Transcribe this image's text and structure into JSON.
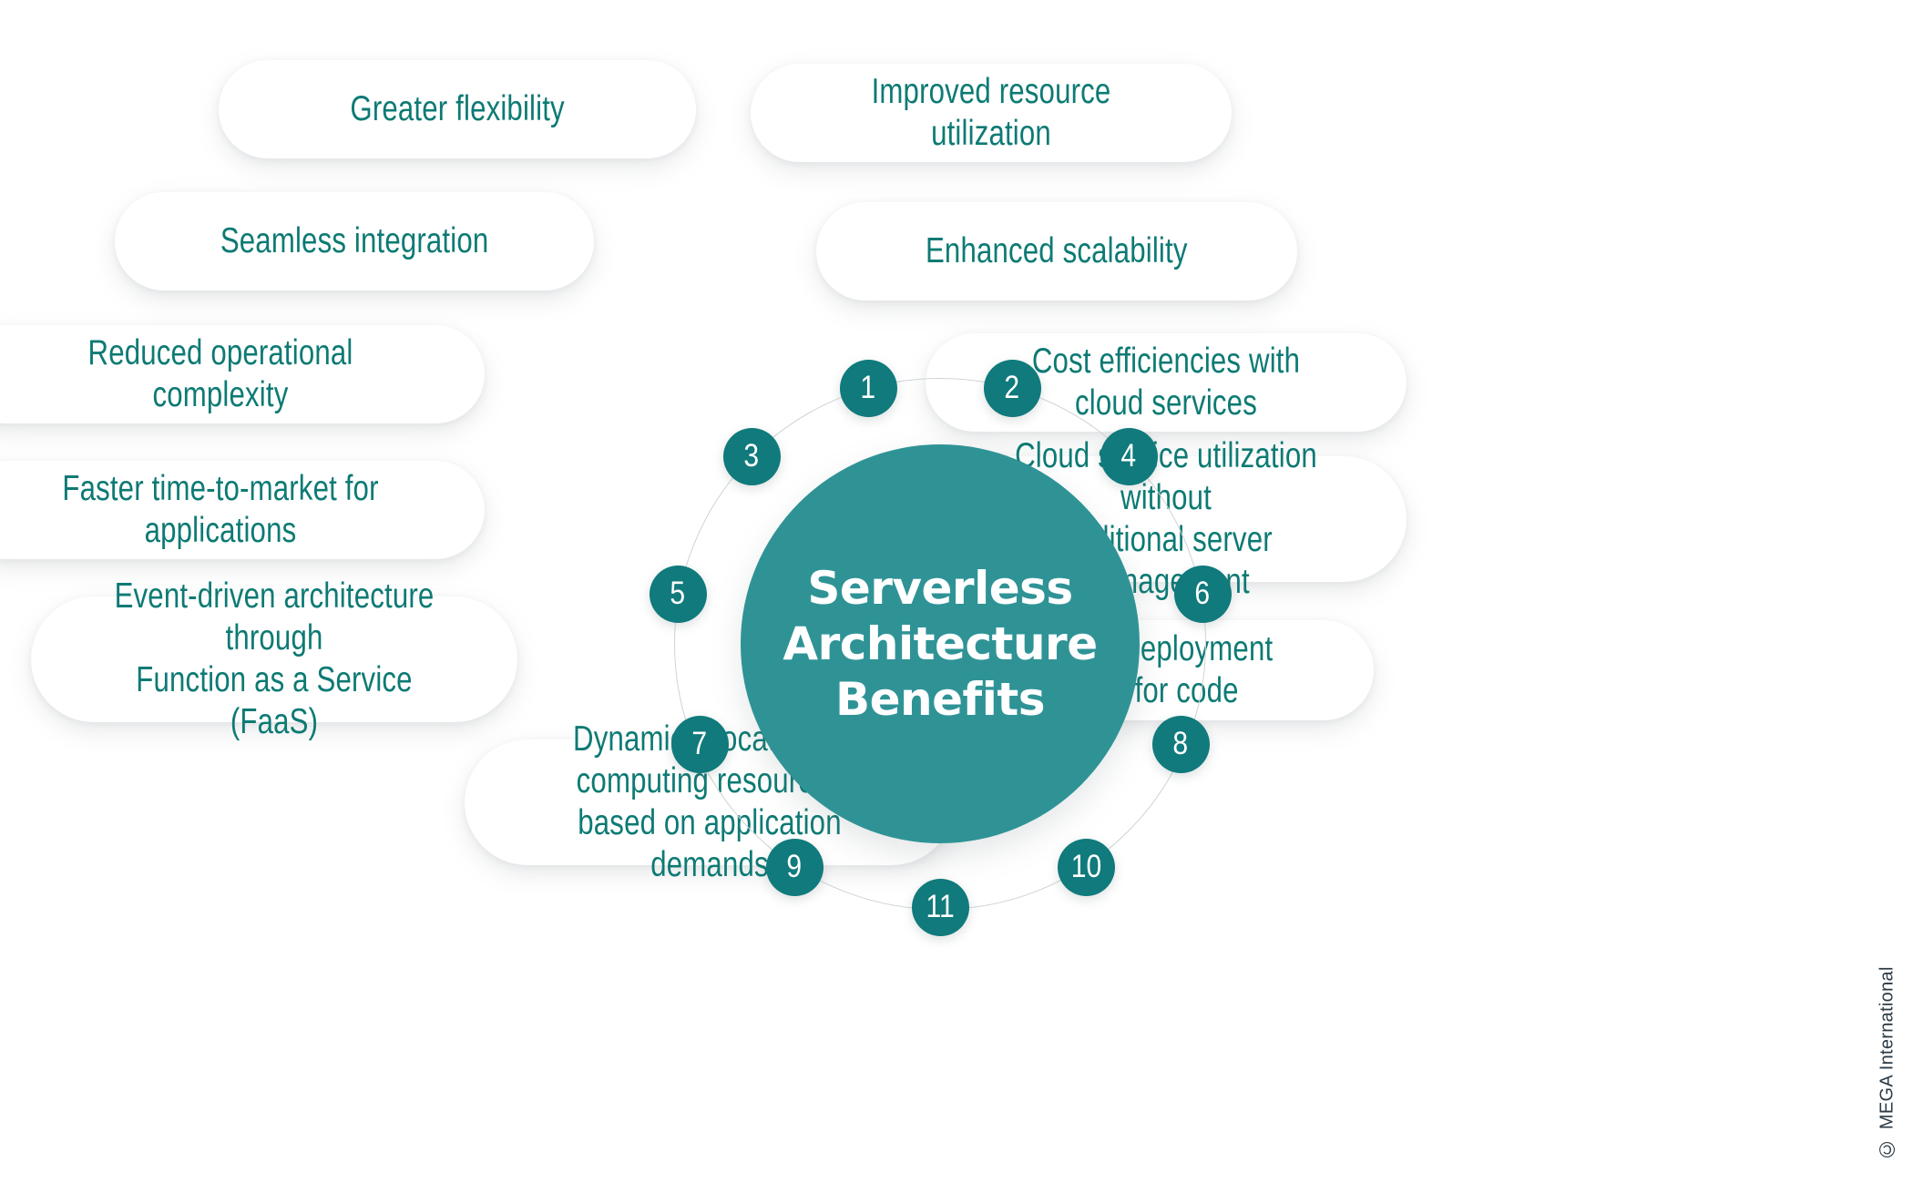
{
  "diagram": {
    "hub_title": "Serverless\nArchitecture\nBenefits",
    "colors": {
      "hub_fill": "#2F9396",
      "node_fill": "#107A7C",
      "label_text": "#0D7A74",
      "pill_background": "#FFFFFF",
      "page_background": "#FFFFFF",
      "ring_line": "#CFD4D6",
      "credit_text": "#2B3A45"
    },
    "nodes": [
      {
        "number": "1",
        "label": "Greater flexibility"
      },
      {
        "number": "2",
        "label": "Improved resource utilization"
      },
      {
        "number": "3",
        "label": "Seamless integration"
      },
      {
        "number": "4",
        "label": "Enhanced scalability"
      },
      {
        "number": "5",
        "label": "Reduced operational complexity"
      },
      {
        "number": "6",
        "label": "Cost efficiencies with cloud services"
      },
      {
        "number": "7",
        "label": "Faster time-to-market for applications"
      },
      {
        "number": "8",
        "label": "Cloud service utilization without\ntraditional server management"
      },
      {
        "number": "9",
        "label": "Event-driven architecture through\nFunction as a Service (FaaS)"
      },
      {
        "number": "10",
        "label": "Simplified deployment process for code"
      },
      {
        "number": "11",
        "label": "Dynamic allocation of computing resources\nbased on application demands"
      }
    ]
  },
  "credit": {
    "mark": "©",
    "text": "MEGA International"
  }
}
